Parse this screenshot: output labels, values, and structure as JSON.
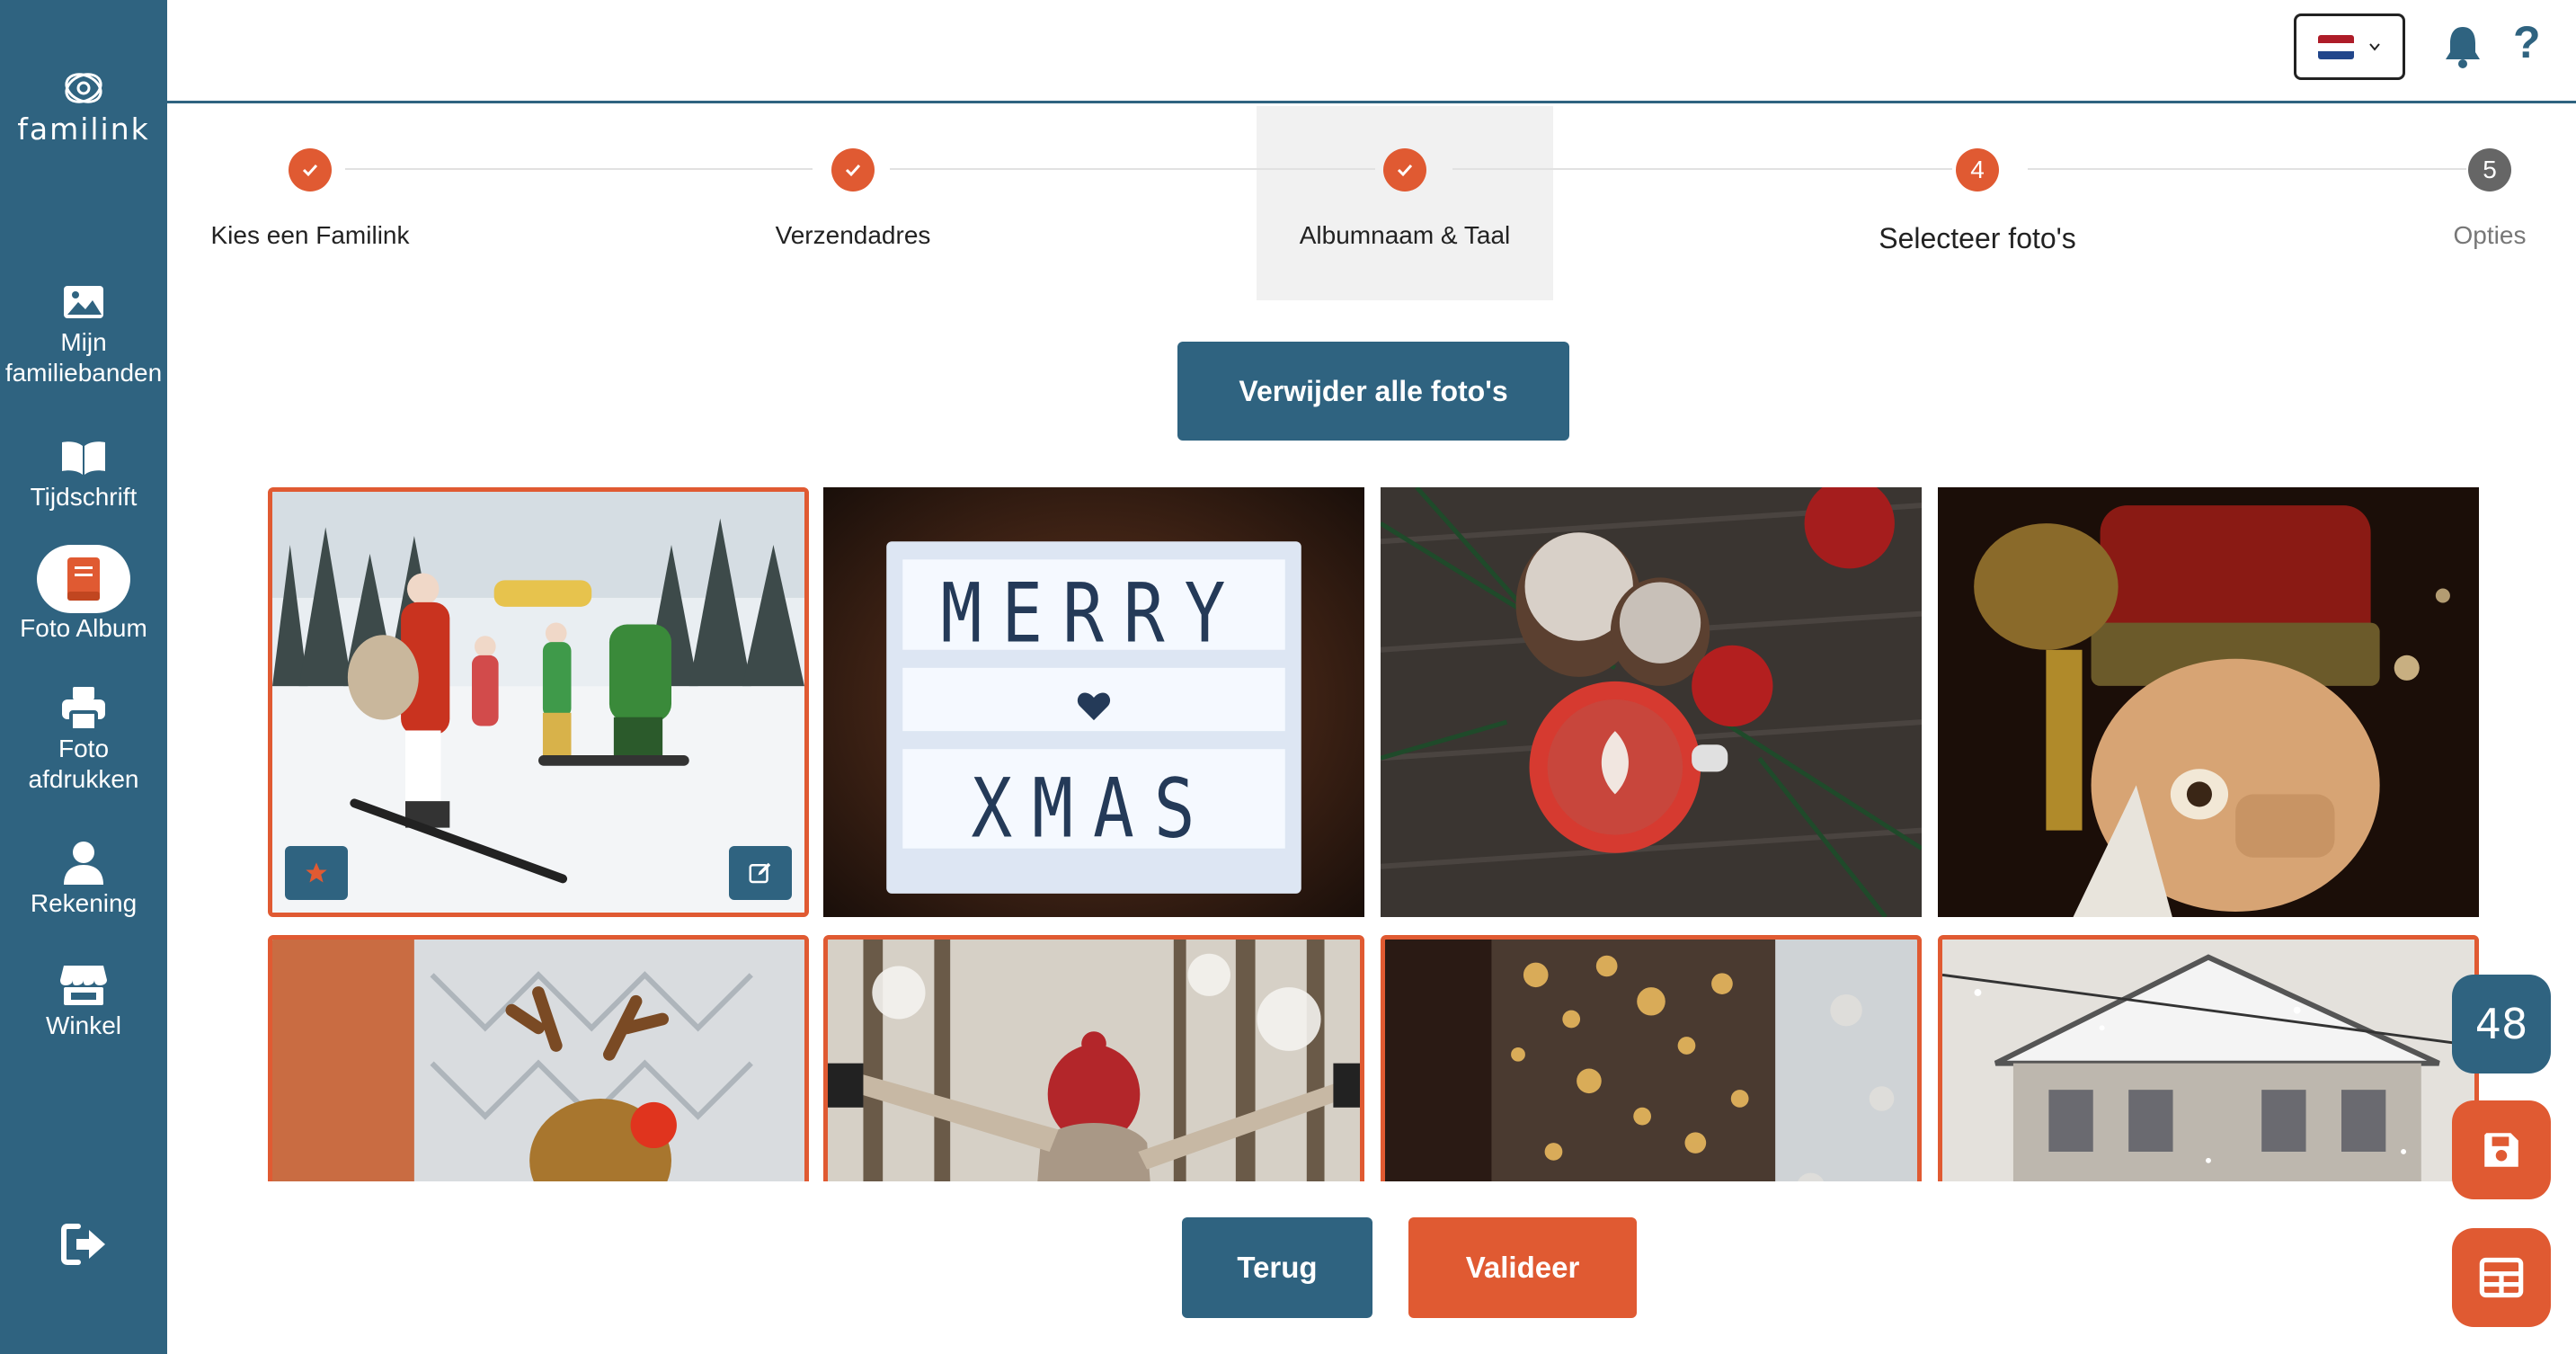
{
  "brand": {
    "name": "familink"
  },
  "sidebar": {
    "items": [
      {
        "label": "Mijn\nfamiliebanden",
        "icon": "image-icon"
      },
      {
        "label": "Tijdschrift",
        "icon": "book-open-icon"
      },
      {
        "label": "Foto Album",
        "icon": "album-icon",
        "active": true
      },
      {
        "label": "Foto\nafdrukken",
        "icon": "printer-icon"
      },
      {
        "label": "Rekening",
        "icon": "user-icon"
      },
      {
        "label": "Winkel",
        "icon": "store-icon"
      }
    ],
    "logout_icon": "logout-icon"
  },
  "topbar": {
    "language": "NL",
    "flag_colors": [
      "#ae1c28",
      "#ffffff",
      "#21468b"
    ],
    "help_label": "?"
  },
  "stepper": {
    "steps": [
      {
        "label": "Kies een Familink",
        "status": "done",
        "number": ""
      },
      {
        "label": "Verzendadres",
        "status": "done",
        "number": ""
      },
      {
        "label": "Albumnaam & Taal",
        "status": "done",
        "number": ""
      },
      {
        "label": "Selecteer foto's",
        "status": "current",
        "number": "4"
      },
      {
        "label": "Opties",
        "status": "todo",
        "number": "5"
      }
    ]
  },
  "actions": {
    "remove_all": "Verwijder alle foto's",
    "back": "Terug",
    "validate": "Valideer"
  },
  "photos": [
    {
      "subject": "Santa and friends skiing in snow",
      "selected": true,
      "favorite": true
    },
    {
      "subject": "Light box sign MERRY XMAS",
      "selected": false
    },
    {
      "subject": "Pine cones, apples and latte",
      "selected": false
    },
    {
      "subject": "Nutcracker figure close-up",
      "selected": false
    },
    {
      "subject": "Plush reindeer toy with scarf",
      "selected": true
    },
    {
      "subject": "Person in red hat in snowy forest",
      "selected": true
    },
    {
      "subject": "Bokeh festive lights",
      "selected": true
    },
    {
      "subject": "Snowy street with building",
      "selected": true
    }
  ],
  "lightbox_text": {
    "line1": "MERRY",
    "line2": "XMAS"
  },
  "floating": {
    "count": "48",
    "save_icon": "save-icon",
    "layout_icon": "layout-grid-icon"
  },
  "colors": {
    "primary": "#2f6380",
    "accent": "#e05a32",
    "step_todo": "#666666"
  }
}
